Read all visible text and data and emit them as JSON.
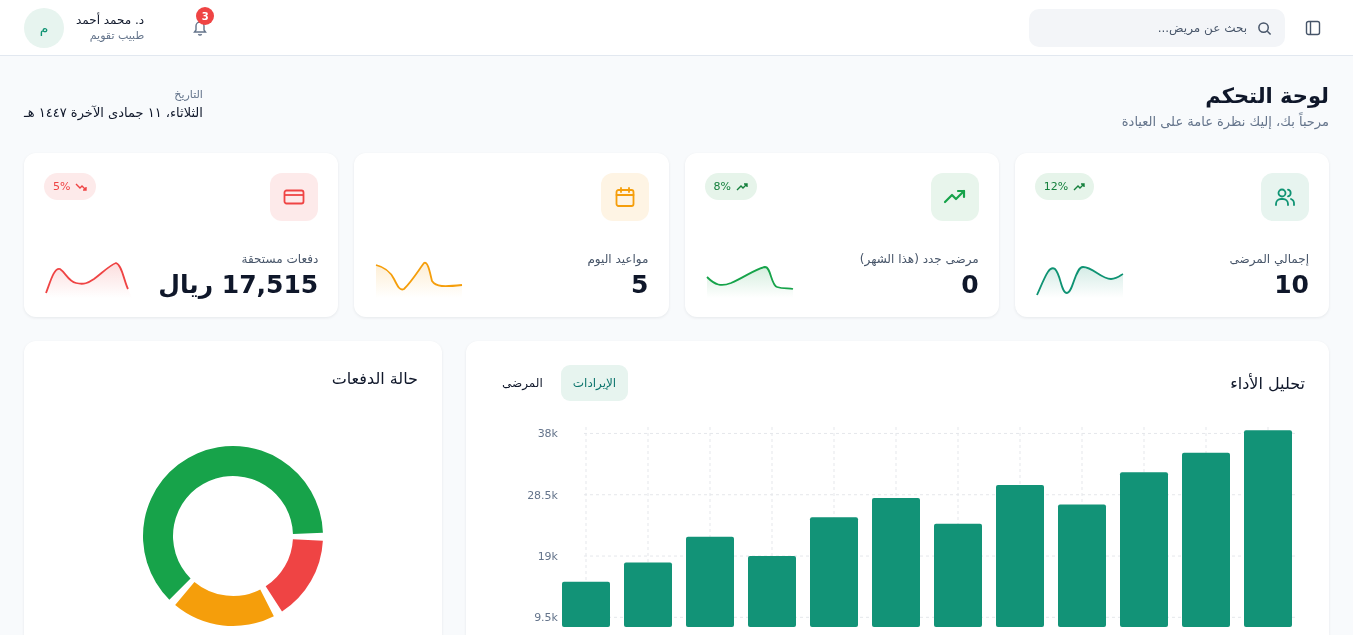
{
  "header": {
    "search": {
      "placeholder": "بحث عن مريض..."
    },
    "notifications": {
      "count": "3"
    },
    "user": {
      "avatar_initial": "م",
      "name": "د. محمد أحمد",
      "role": "طبيب تقويم"
    }
  },
  "page": {
    "title": "لوحة التحكم",
    "subtitle": "مرحباً بك، إليك نظرة عامة على العيادة",
    "date_label": "التاريخ",
    "date": "الثلاثاء، ١١ جمادى الآخرة ١٤٤٧ هـ"
  },
  "stats": [
    {
      "kind": "patients",
      "label": "إجمالي المرضى",
      "value": "10",
      "change": "12%",
      "falling": false,
      "color": "#0f9373"
    },
    {
      "kind": "growth",
      "label": "مرضى جدد (هذا الشهر)",
      "value": "0",
      "change": "8%",
      "falling": false,
      "color": "#16a34a"
    },
    {
      "kind": "calendar",
      "label": "مواعيد اليوم",
      "value": "5",
      "color": "#f59e0b"
    },
    {
      "kind": "payments",
      "label": "دفعات مستحقة",
      "value": "17,515 ريال",
      "change": "5%",
      "falling": true,
      "color": "#ef4444"
    }
  ],
  "performance": {
    "title": "تحليل الأداء",
    "tabs": [
      {
        "label": "الإيرادات",
        "selected": true
      },
      {
        "label": "المرضى",
        "selected": false
      }
    ],
    "chart_data": {
      "type": "bar",
      "grid": true,
      "ylim": [
        8000,
        39000
      ],
      "yticks": [
        {
          "value": 38000,
          "label": "38k"
        },
        {
          "value": 28500,
          "label": "28.5k"
        },
        {
          "value": 19000,
          "label": "19k"
        },
        {
          "value": 9500,
          "label": "9.5k"
        }
      ],
      "series": [
        {
          "color": "#129377",
          "values": [
            15000,
            18000,
            22000,
            19000,
            25000,
            28000,
            24000,
            30000,
            27000,
            32000,
            35000,
            38500
          ]
        }
      ]
    }
  },
  "payments_status": {
    "title": "حالة الدفعات"
  }
}
